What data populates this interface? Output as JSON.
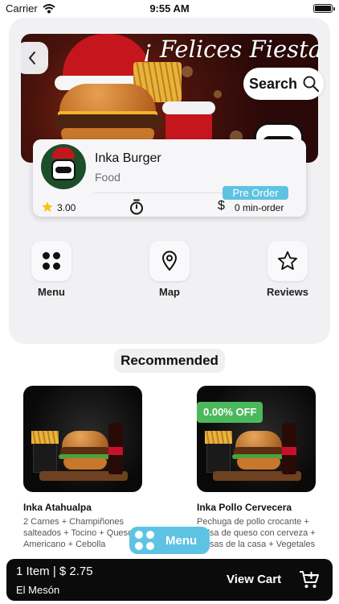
{
  "status_bar": {
    "carrier": "Carrier",
    "time": "9:55 AM"
  },
  "banner": {
    "title": "¡ Felices Fiestas !"
  },
  "search": {
    "label": "Search"
  },
  "restaurant": {
    "name": "Inka Burger",
    "category": "Food",
    "badge": "Pre Order",
    "rating": "3.00",
    "min_order": "0 min-order"
  },
  "actions": [
    {
      "label": "Menu",
      "icon": "grid-icon"
    },
    {
      "label": "Map",
      "icon": "map-pin-icon"
    },
    {
      "label": "Reviews",
      "icon": "star-outline-icon"
    }
  ],
  "recommended": {
    "title": "Recommended",
    "products": [
      {
        "name": "Inka Atahualpa",
        "desc": "2 Carnes + Champiñones salteados + Tocino + Queso Americano + Cebolla",
        "discount": ""
      },
      {
        "name": "Inka Pollo Cervecera",
        "desc": "Pechuga de pollo crocante + Salsa de queso con cerveza + Salsas de la casa + Vegetales",
        "discount": "0.00% OFF"
      }
    ]
  },
  "floating_menu": {
    "label": "Menu"
  },
  "cart": {
    "summary": "1 Item | $ 2.75",
    "place": "El Mesón",
    "cta": "View Cart"
  },
  "colors": {
    "accent": "#5ec3e3",
    "discount": "#4cb85c",
    "cart_bar": "#0b0b0b",
    "panel": "#f1f1f4"
  }
}
